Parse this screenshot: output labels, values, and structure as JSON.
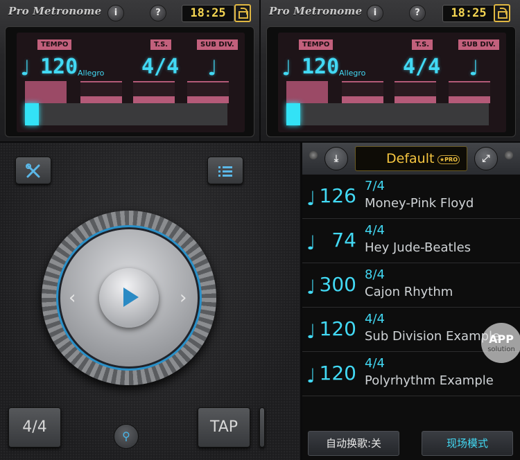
{
  "header": {
    "app_title": "Pro Metronome",
    "info_icon": "i",
    "help_icon": "?",
    "clock": "18:25"
  },
  "lcd": {
    "tempo_tag": "TEMPO",
    "ts_tag": "T.S.",
    "subdiv_tag": "SUB DIV.",
    "tempo_value": "120",
    "tempo_name": "Allegro",
    "time_signature": "4/4",
    "note_symbol": "♩",
    "beat_progress": 0.07
  },
  "controls": {
    "ts_button": "4/4",
    "tap_button": "TAP",
    "prev_symbol": "‹",
    "next_symbol": "›"
  },
  "list": {
    "preset_name": "Default",
    "pro_badge": "★PRO",
    "songs": [
      {
        "bpm": "126",
        "ts": "7/4",
        "name": "Money-Pink Floyd"
      },
      {
        "bpm": "74",
        "ts": "4/4",
        "name": "Hey Jude-Beatles"
      },
      {
        "bpm": "300",
        "ts": "8/4",
        "name": "Cajon Rhythm"
      },
      {
        "bpm": "120",
        "ts": "4/4",
        "name": "Sub Division Example"
      },
      {
        "bpm": "120",
        "ts": "4/4",
        "name": "Polyrhythm Example"
      }
    ],
    "auto_switch": "自动换歌:关",
    "live_mode": "现场模式"
  },
  "watermark": {
    "line1": "APP",
    "line2": "solution"
  },
  "colors": {
    "cyan": "#42d9f4",
    "gold": "#f6c640",
    "pink": "#c2607c"
  }
}
